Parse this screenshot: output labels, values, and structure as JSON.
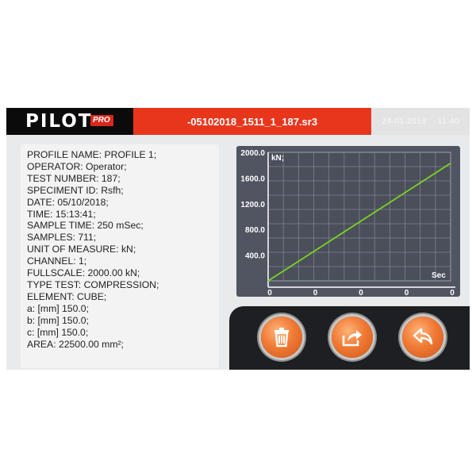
{
  "header": {
    "logo_text": "PILOT",
    "logo_badge": "PRO",
    "filename": "-05102018_1511_1_187.sr3",
    "date": "24-01-2019",
    "time": "11:40"
  },
  "info": {
    "lines": [
      "PROFILE NAME: PROFILE 1;",
      "OPERATOR: Operator;",
      "TEST NUMBER: 187;",
      "SPECIMENT ID: Rsfh;",
      "DATE: 05/10/2018;",
      "TIME: 15:13:41;",
      "SAMPLE TIME: 250 mSec;",
      "SAMPLES: 711;",
      "UNIT OF MEASURE: kN;",
      "CHANNEL: 1;",
      "FULLSCALE: 2000.00 kN;",
      "TYPE TEST: COMPRESSION;",
      "ELEMENT: CUBE;",
      "a: [mm] 150.0;",
      "b: [mm] 150.0;",
      "c: [mm] 150.0;",
      "AREA: 22500.00 mm²;"
    ]
  },
  "chart_data": {
    "type": "line",
    "ylabel": "kN;",
    "xlabel": "Sec",
    "ylim": [
      0,
      2000
    ],
    "y_ticks": [
      "2000.0",
      "1600.0",
      "1200.0",
      "800.0",
      "400.0"
    ],
    "x_ticks": [
      "0",
      "0",
      "0",
      "0",
      "0"
    ],
    "grid": true,
    "line_color": "#7ed321",
    "series": [
      {
        "x": [
          0,
          1
        ],
        "values": [
          0,
          1830
        ]
      }
    ]
  },
  "buttons": [
    {
      "icon": "trash-icon",
      "label": "delete"
    },
    {
      "icon": "export-icon",
      "label": "export"
    },
    {
      "icon": "back-arrow-icon",
      "label": "back"
    }
  ],
  "colors": {
    "brand_red": "#e8361d",
    "button_orange": "#f07a34",
    "chart_bg": "#505561"
  }
}
